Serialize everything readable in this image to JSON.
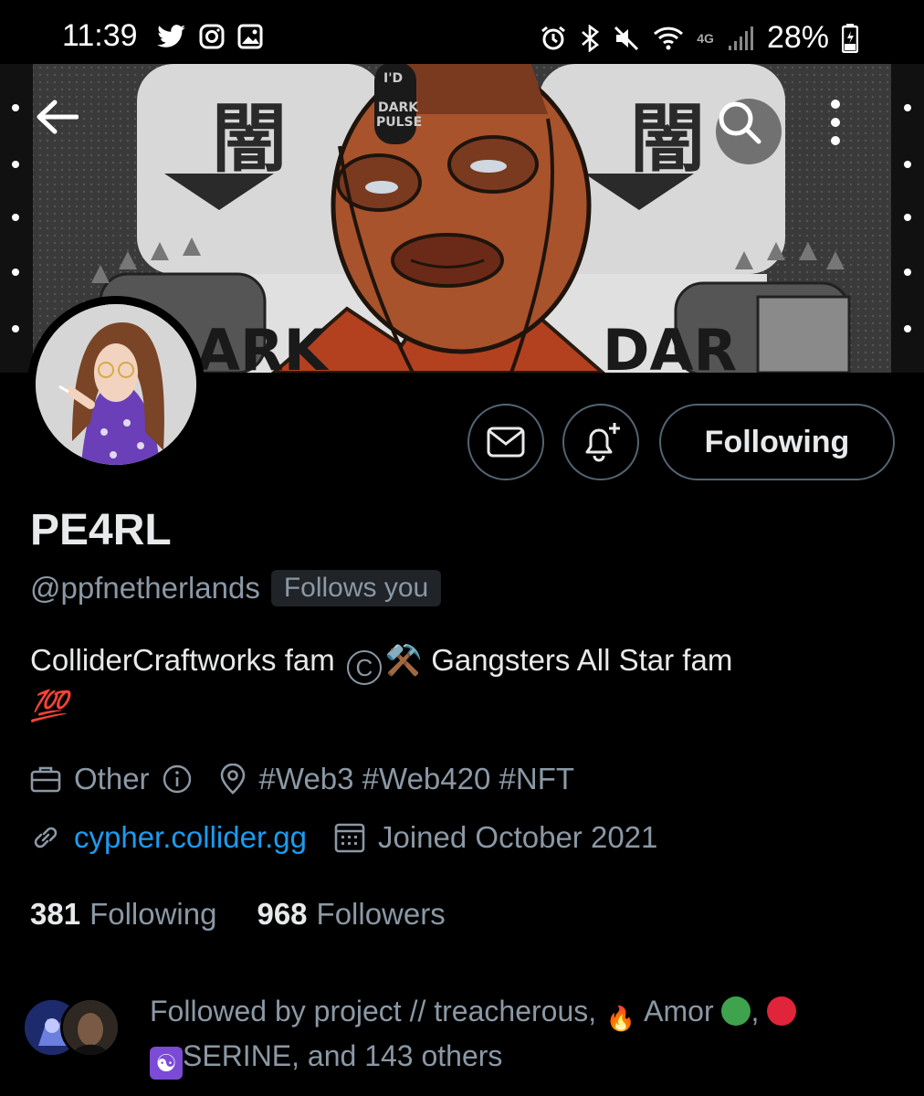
{
  "status_bar": {
    "time": "11:39",
    "battery": "28%",
    "network": "4G"
  },
  "banner": {
    "kanji_left": "闇",
    "kanji_right": "闇",
    "mask_text_line1": "DARK",
    "mask_text_line2": "PULSE",
    "mask_top": "I'D",
    "text_left": "ARK",
    "text_right": "DAR"
  },
  "profile": {
    "name": "PE4RL",
    "handle": "@ppfnetherlands",
    "follows_you": "Follows you",
    "bio_part1": "ColliderCraftworks fam",
    "bio_part2": "Gangsters All Star fam",
    "bio_copyright": "C",
    "bio_hammer": "⚒️",
    "bio_100": "💯",
    "category": "Other",
    "location": "#Web3 #Web420 #NFT",
    "website": "cypher.collider.gg",
    "joined": "Joined October 2021",
    "following_count": "381",
    "following_label": "Following",
    "followers_count": "968",
    "followers_label": "Followers"
  },
  "actions": {
    "following_button": "Following"
  },
  "followed_by": {
    "prefix": "Followed by project // treacherous,",
    "amor": "Amor",
    "serine": "SERINE, and 143 others",
    "fire_emoji": "🔥",
    "yin_yang": "☯"
  },
  "colors": {
    "accent": "#1d9bf0",
    "muted": "#8b98a5",
    "border": "#536471",
    "green_dot": "#3fa34d",
    "red_dot": "#e0243a",
    "purple": "#7b4bd6"
  },
  "icons": [
    "twitter-icon",
    "instagram-icon",
    "gallery-icon",
    "alarm-icon",
    "bluetooth-icon",
    "mute-icon",
    "wifi-icon",
    "signal-icon",
    "battery-icon",
    "back-arrow-icon",
    "search-icon",
    "more-icon",
    "mail-icon",
    "bell-plus-icon",
    "briefcase-icon",
    "info-icon",
    "location-pin-icon",
    "link-icon",
    "calendar-icon"
  ]
}
